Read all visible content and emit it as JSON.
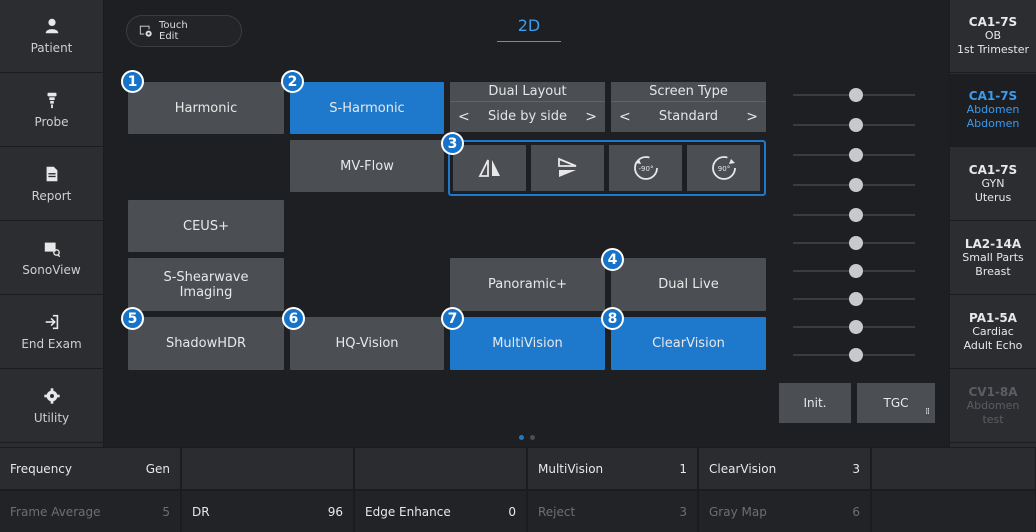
{
  "left_nav": [
    {
      "label": "Patient",
      "icon": "person-icon"
    },
    {
      "label": "Probe",
      "icon": "probe-icon"
    },
    {
      "label": "Report",
      "icon": "report-icon"
    },
    {
      "label": "SonoView",
      "icon": "sonoview-icon"
    },
    {
      "label": "End Exam",
      "icon": "end-exam-icon"
    },
    {
      "label": "Utility",
      "icon": "gear-icon"
    }
  ],
  "touch_edit": {
    "line1": "Touch",
    "line2": "Edit"
  },
  "mode_title": "2D",
  "buttons": {
    "harmonic": "Harmonic",
    "s_harmonic": "S-Harmonic",
    "mv_flow": "MV-Flow",
    "ceus": "CEUS+",
    "shearwave": "S-Shearwave Imaging",
    "panoramic": "Panoramic+",
    "dual_live": "Dual Live",
    "shadowhdr": "ShadowHDR",
    "hq_vision": "HQ-Vision",
    "multivision": "MultiVision",
    "clearvision": "ClearVision"
  },
  "dual_layout": {
    "title": "Dual Layout",
    "value": "Side by side",
    "prev": "<",
    "next": ">"
  },
  "screen_type": {
    "title": "Screen Type",
    "value": "Standard",
    "prev": "<",
    "next": ">"
  },
  "rotate_buttons": [
    {
      "icon": "flip-horizontal-icon"
    },
    {
      "icon": "flip-vertical-icon"
    },
    {
      "icon": "rotate-ccw-90-icon",
      "label": "-90°"
    },
    {
      "icon": "rotate-cw-90-icon",
      "label": "90°"
    }
  ],
  "badges": [
    "1",
    "2",
    "3",
    "4",
    "5",
    "6",
    "7",
    "8"
  ],
  "tgc": {
    "init": "Init.",
    "tgc": "TGC",
    "knob_count": 8
  },
  "probes": [
    {
      "name": "CA1-7S",
      "line2": "OB",
      "line3": "1st Trimester",
      "state": "normal"
    },
    {
      "name": "CA1-7S",
      "line2": "Abdomen",
      "line3": "Abdomen",
      "state": "active"
    },
    {
      "name": "CA1-7S",
      "line2": "GYN",
      "line3": "Uterus",
      "state": "normal"
    },
    {
      "name": "LA2-14A",
      "line2": "Small Parts",
      "line3": "Breast",
      "state": "normal"
    },
    {
      "name": "PA1-5A",
      "line2": "Cardiac",
      "line3": "Adult Echo",
      "state": "normal"
    },
    {
      "name": "CV1-8A",
      "line2": "Abdomen",
      "line3": "test",
      "state": "disabled"
    }
  ],
  "bottom_row1": [
    {
      "label": "Frequency",
      "value": "Gen"
    },
    {
      "label": "",
      "value": ""
    },
    {
      "label": "",
      "value": ""
    },
    {
      "label": "MultiVision",
      "value": "1"
    },
    {
      "label": "ClearVision",
      "value": "3"
    },
    {
      "label": "",
      "value": ""
    }
  ],
  "bottom_row2": [
    {
      "label": "Frame Average",
      "value": "5"
    },
    {
      "label": "DR",
      "value": "96"
    },
    {
      "label": "Edge Enhance",
      "value": "0"
    },
    {
      "label": "Reject",
      "value": "3"
    },
    {
      "label": "Gray Map",
      "value": "6"
    },
    {
      "label": "",
      "value": ""
    }
  ],
  "colors": {
    "accent": "#1e78cc",
    "title_blue": "#3a9cf0",
    "button": "#4b4e53"
  }
}
